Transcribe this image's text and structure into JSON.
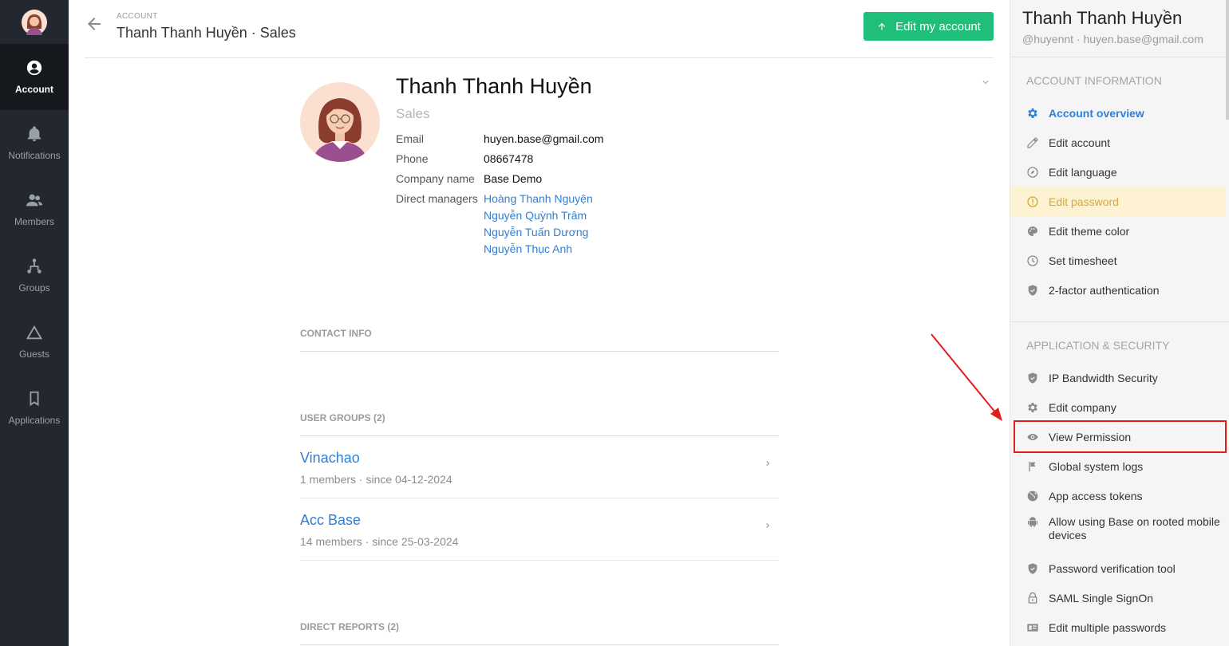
{
  "nav": {
    "items": [
      {
        "label": "Account",
        "icon": "account-circle-icon",
        "active": true
      },
      {
        "label": "Notifications",
        "icon": "bell-icon"
      },
      {
        "label": "Members",
        "icon": "members-icon"
      },
      {
        "label": "Groups",
        "icon": "groups-icon"
      },
      {
        "label": "Guests",
        "icon": "triangle-icon"
      },
      {
        "label": "Applications",
        "icon": "bookmark-icon"
      }
    ]
  },
  "header": {
    "breadcrumb": "ACCOUNT",
    "title": "Thanh Thanh Huyền · Sales",
    "edit_button": "Edit my account"
  },
  "profile": {
    "name": "Thanh Thanh Huyền",
    "title": "Sales",
    "fields": [
      {
        "label": "Email",
        "value": "huyen.base@gmail.com"
      },
      {
        "label": "Phone",
        "value": "08667478"
      },
      {
        "label": "Company name",
        "value": "Base Demo"
      },
      {
        "label": "Direct managers",
        "value": ""
      }
    ],
    "managers": [
      "Hoàng Thanh Nguyện",
      "Nguyễn Quỳnh Trâm",
      "Nguyễn Tuấn Dương",
      "Nguyễn Thục Anh"
    ]
  },
  "sections": {
    "contact_info": "CONTACT INFO",
    "user_groups": "USER GROUPS (2)",
    "direct_reports": "DIRECT REPORTS (2)"
  },
  "groups": [
    {
      "name": "Vinachao",
      "meta": "1 members · since 04-12-2024"
    },
    {
      "name": "Acc Base",
      "meta": "14 members · since 25-03-2024"
    }
  ],
  "panel": {
    "name": "Thanh Thanh Huyền",
    "handle": "@huyennt  ·  huyen.base@gmail.com",
    "account_info_title": "ACCOUNT INFORMATION",
    "account_items": [
      {
        "label": "Account overview",
        "icon": "gear-icon",
        "state": "active"
      },
      {
        "label": "Edit account",
        "icon": "pencil-icon"
      },
      {
        "label": "Edit language",
        "icon": "compass-icon"
      },
      {
        "label": "Edit password",
        "icon": "alert-circle-icon",
        "state": "warn"
      },
      {
        "label": "Edit theme color",
        "icon": "palette-icon"
      },
      {
        "label": "Set timesheet",
        "icon": "clock-icon"
      },
      {
        "label": "2-factor authentication",
        "icon": "shield-icon"
      }
    ],
    "security_title": "APPLICATION & SECURITY",
    "security_items": [
      {
        "label": "IP Bandwidth Security",
        "icon": "shield-icon"
      },
      {
        "label": "Edit company",
        "icon": "gear-icon"
      },
      {
        "label": "View Permission",
        "icon": "eye-icon"
      },
      {
        "label": "Global system logs",
        "icon": "flag-icon"
      },
      {
        "label": "App access tokens",
        "icon": "globe-icon"
      },
      {
        "label": "Allow using Base on rooted mobile devices",
        "icon": "android-icon"
      },
      {
        "label": "Password verification tool",
        "icon": "shield-icon"
      },
      {
        "label": "SAML Single SignOn",
        "icon": "lock-icon"
      },
      {
        "label": "Edit multiple passwords",
        "icon": "id-card-icon"
      }
    ]
  },
  "colors": {
    "sidebar": "#23272f",
    "accent_blue": "#2f7fd6",
    "green_button": "#1fbf7a",
    "annotation_red": "#e51c1c",
    "warn": "#d6a935"
  }
}
